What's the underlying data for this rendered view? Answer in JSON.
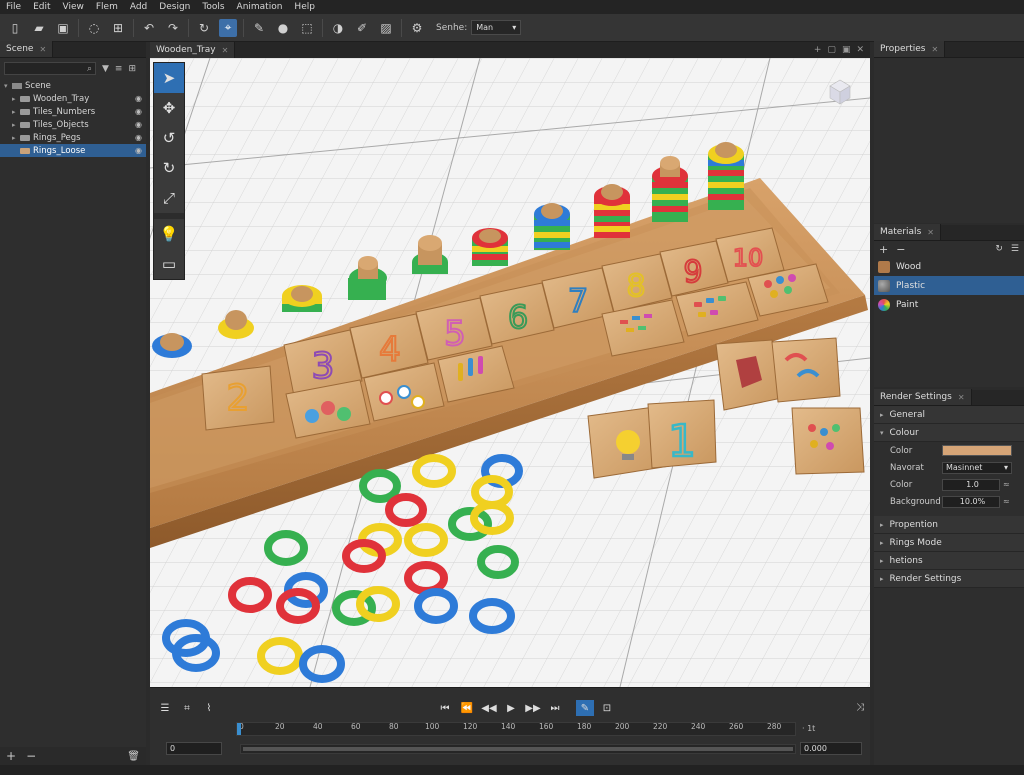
{
  "menu": [
    "File",
    "Edit",
    "View",
    "Flem",
    "Add",
    "Design",
    "Tools",
    "Animation",
    "Help"
  ],
  "toolbar": {
    "scene_label": "Senhe:",
    "scene_value": "Man"
  },
  "scene_panel": {
    "tab": "Scene",
    "root": "Scene",
    "items": [
      {
        "label": "Wooden_Tray",
        "selected": false
      },
      {
        "label": "Tiles_Numbers",
        "selected": false
      },
      {
        "label": "Tiles_Objects",
        "selected": false
      },
      {
        "label": "Rings_Pegs",
        "selected": false
      },
      {
        "label": "Rings_Loose",
        "selected": true
      }
    ]
  },
  "viewport": {
    "tab": "Wooden_Tray"
  },
  "scene3d": {
    "tray_numbers": [
      "2",
      "3",
      "4",
      "5",
      "6",
      "7",
      "8",
      "9",
      "10"
    ],
    "loose_tile_number": "1"
  },
  "timeline": {
    "ticks": [
      "0",
      "20",
      "40",
      "60",
      "80",
      "100",
      "120",
      "140",
      "160",
      "180",
      "200",
      "220",
      "240",
      "260",
      "280"
    ],
    "start_value": "0",
    "end_value": "0.000",
    "fps_label": "· 1t"
  },
  "properties": {
    "tab": "Properties"
  },
  "materials": {
    "tab": "Materials",
    "items": [
      {
        "label": "Wood",
        "color": "#b07a4a",
        "selected": false
      },
      {
        "label": "Plastic",
        "color": "#7a7a7a",
        "selected": true
      },
      {
        "label": "Paint",
        "color": "#e05ac0",
        "selected": false
      }
    ]
  },
  "render_settings": {
    "tab": "Render Settings",
    "general": "General",
    "colour": "Colour",
    "fields": {
      "color_label": "Color",
      "color_value": "#d6a577",
      "navorat_label": "Navorat",
      "navorat_value": "Masinnet",
      "colour2_label": "Color",
      "colour2_value": "1.0",
      "background_label": "Background",
      "background_value": "10.0%"
    },
    "sections": [
      "Propention",
      "Rings Mode",
      "hetions",
      "Render Settings"
    ]
  },
  "colors": {
    "accent": "#2f5f93",
    "active_tool": "#2e6fb3"
  }
}
